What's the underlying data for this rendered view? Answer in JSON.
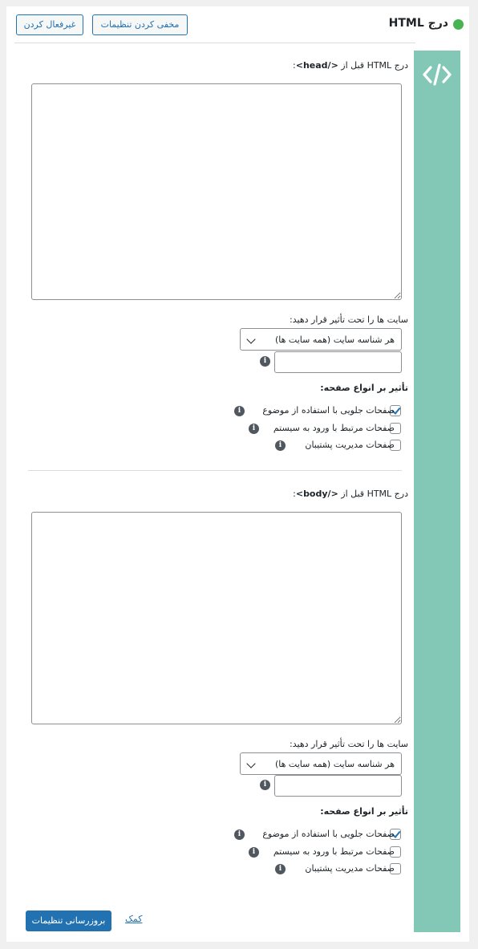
{
  "header": {
    "title": "درج HTML",
    "hide_settings": "مخفی کردن تنظیمات",
    "disable": "غیرفعال کردن",
    "status_color": "#46b450"
  },
  "sidebar": {
    "icon": "code-icon",
    "color": "#83c8b6"
  },
  "head_section": {
    "label_prefix": "درج HTML قبل از",
    "tag": "</head>",
    "label_suffix": ":",
    "code_value": "",
    "sites_label": "سایت ها را تحت تأثیر قرار دهید:",
    "sites_selected": "هر شناسه سایت (همه سایت ها)",
    "site_id_value": "",
    "page_types_label": "تأثیر بر انواع صفحه:",
    "page_types": [
      {
        "label": "صفحات جلویی با استفاده از موضوع",
        "checked": true
      },
      {
        "label": "صفحات مرتبط با ورود به سیستم",
        "checked": false
      },
      {
        "label": "صفحات مدیریت پشتیبان",
        "checked": false
      }
    ]
  },
  "body_section": {
    "label_prefix": "درج HTML قبل از",
    "tag": "</body>",
    "label_suffix": ":",
    "code_value": "",
    "sites_label": "سایت ها را تحت تأثیر قرار دهید:",
    "sites_selected": "هر شناسه سایت (همه سایت ها)",
    "site_id_value": "",
    "page_types_label": "تأثیر بر انواع صفحه:",
    "page_types": [
      {
        "label": "صفحات جلویی با استفاده از موضوع",
        "checked": true
      },
      {
        "label": "صفحات مرتبط با ورود به سیستم",
        "checked": false
      },
      {
        "label": "صفحات مدیریت پشتیبان",
        "checked": false
      }
    ]
  },
  "footer": {
    "update_button": "بروزرسانی تنظیمات",
    "help_link": "کمک"
  },
  "colors": {
    "accent": "#2271b1",
    "info": "#50575e"
  }
}
